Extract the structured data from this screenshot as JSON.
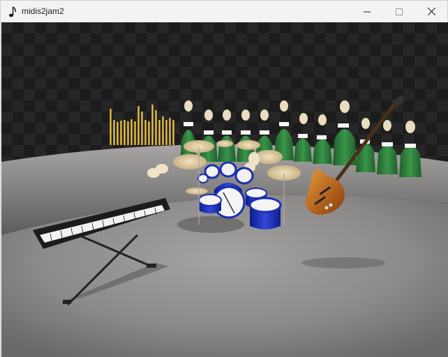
{
  "window": {
    "title": "midis2jam2",
    "app_icon": "eighth-note-icon",
    "controls": {
      "minimize_icon": "minimize-icon",
      "maximize_icon": "maximize-icon",
      "close_icon": "close-icon"
    }
  },
  "scene": {
    "background_color": "#1f1f1f",
    "stage_color": "#6e6d6b",
    "instruments": [
      "pipe-organ",
      "choir",
      "drum-set",
      "keyboard",
      "bass-guitar"
    ],
    "choir_robe_color": "#2e7d3a",
    "drum_color": "#1a2fb0",
    "guitar_color": "#c5661a"
  }
}
